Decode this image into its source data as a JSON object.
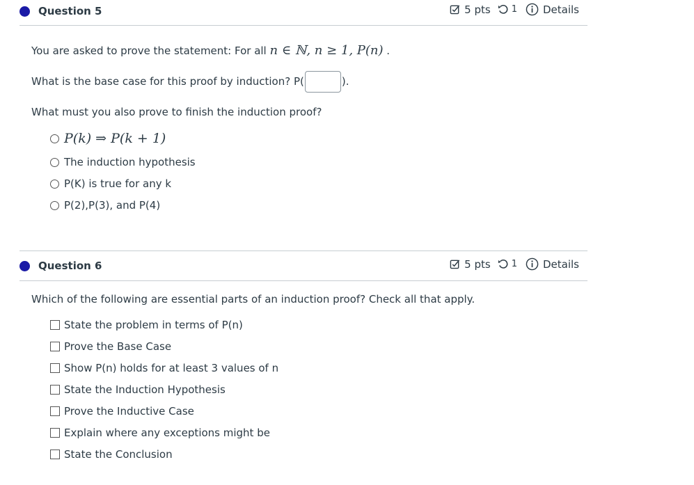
{
  "q5": {
    "title": "Question 5",
    "pts": "5 pts",
    "attempts": "1",
    "details": "Details",
    "statement_prefix": "You are asked to prove the statement: For all ",
    "statement_math": "n ∈ ℕ, n ≥ 1, P(n)",
    "statement_suffix": " .",
    "base_prefix": "What is the base case for this proof by induction? P(",
    "base_value": "",
    "base_suffix": ").",
    "finish_prompt": "What must you also prove to finish the induction proof?",
    "options": [
      "P(k) ⇒ P(k + 1)",
      "The induction hypothesis",
      "P(K) is true for any k",
      "P(2),P(3), and P(4)"
    ]
  },
  "q6": {
    "title": "Question 6",
    "pts": "5 pts",
    "attempts": "1",
    "details": "Details",
    "prompt": "Which of the following are essential parts of an induction proof? Check all that apply.",
    "options": [
      "State the problem in terms of P(n)",
      "Prove the Base Case",
      "Show P(n) holds for at least 3 values of n",
      "State the Induction Hypothesis",
      "Prove the Inductive Case",
      "Explain where any exceptions might be",
      "State the Conclusion"
    ]
  },
  "colors": {
    "accent": "#1a1aa6",
    "text": "#2d3b45",
    "rule": "#c7cdd1"
  },
  "icons": {
    "pts": "checkbox-edit-icon",
    "attempts": "undo-icon",
    "details": "info-circle-icon"
  }
}
